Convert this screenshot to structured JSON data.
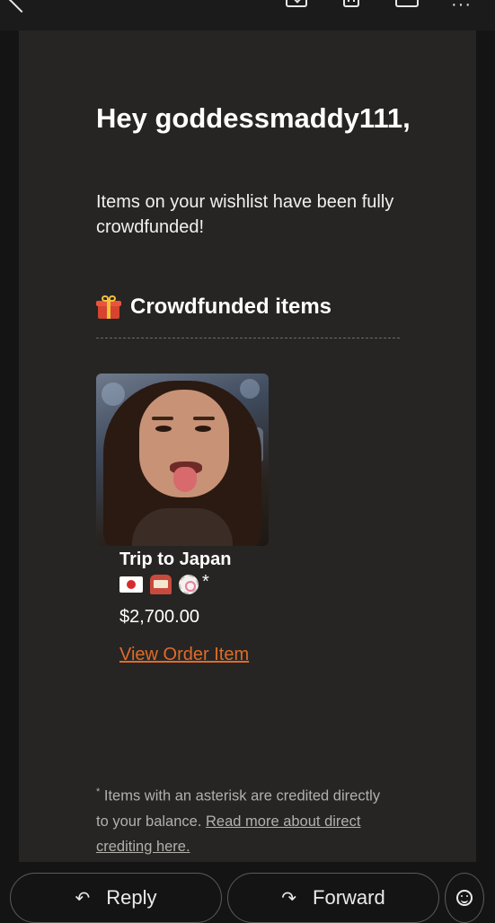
{
  "toolbar": {
    "icons": [
      "back-icon",
      "archive-icon",
      "delete-icon",
      "mark-unread-icon",
      "more-icon"
    ],
    "more_glyph": "···"
  },
  "email": {
    "greeting": "Hey goddessmaddy111,",
    "intro": "Items on your wishlist have been fully crowdfunded!",
    "section_heading": "Crowdfunded items",
    "section_icon": "gift-icon",
    "item": {
      "name": "Trip to Japan",
      "emoji_icons": [
        "japan-flag-icon",
        "slot-machine-icon",
        "fish-cake-icon"
      ],
      "asterisk": "*",
      "price": "$2,700.00",
      "link_label": "View Order Item"
    },
    "footnote": {
      "marker": "*",
      "text": " Items with an asterisk are credited directly to your balance. ",
      "link_label": "Read more about direct crediting here."
    }
  },
  "actions": {
    "reply_label": "Reply",
    "forward_label": "Forward",
    "reply_glyph": "↶",
    "forward_glyph": "↷"
  },
  "colors": {
    "background": "#141414",
    "card": "#262523",
    "link": "#e06b2a"
  }
}
